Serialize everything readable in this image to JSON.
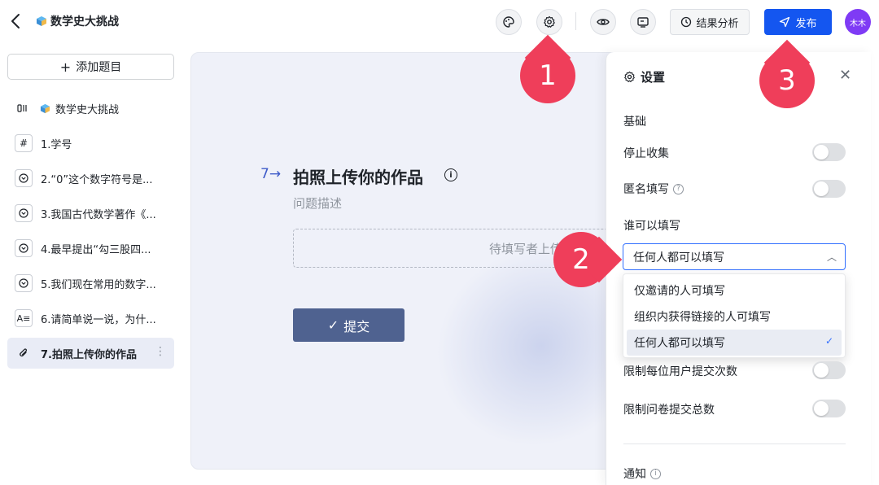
{
  "header": {
    "back_icon": "chevron-left-icon",
    "title": "数学史大挑战",
    "analysis_label": "结果分析",
    "publish_label": "发布",
    "avatar_text": "木木"
  },
  "sidebar": {
    "add_label": "添加题目",
    "items": [
      {
        "icon": "cover-icon",
        "label": "数学史大挑战"
      },
      {
        "icon": "number-icon",
        "label": "1.学号"
      },
      {
        "icon": "single-choice-icon",
        "label": "2.“0”这个数字符号是..."
      },
      {
        "icon": "single-choice-icon",
        "label": "3.我国古代数学著作《..."
      },
      {
        "icon": "single-choice-icon",
        "label": "4.最早提出“勾三股四..."
      },
      {
        "icon": "single-choice-icon",
        "label": "5.我们现在常用的数字..."
      },
      {
        "icon": "text-icon",
        "label": "6.请简单说一说，为什..."
      },
      {
        "icon": "attachment-icon",
        "label": "7.拍照上传你的作品"
      }
    ]
  },
  "question": {
    "number": "7→",
    "title": "拍照上传你的作品",
    "description": "问题描述",
    "upload_placeholder": "待填写者上传",
    "submit_label": "提交"
  },
  "settings": {
    "title": "设置",
    "section_basic": "基础",
    "stop_collect": "停止收集",
    "anonymous": "匿名填写",
    "who_can_fill": "谁可以填写",
    "selected_value": "任何人都可以填写",
    "options": [
      "仅邀请的人可填写",
      "组织内获得链接的人可填写",
      "任何人都可以填写"
    ],
    "limit_per_user": "限制每位用户提交次数",
    "limit_total": "限制问卷提交总数",
    "section_notify": "通知"
  },
  "callouts": [
    "1",
    "2",
    "3"
  ],
  "colors": {
    "accent": "#1456f0",
    "callout": "#ef3e5a",
    "submit": "#4f6290",
    "avatar": "#7f3bf5"
  }
}
